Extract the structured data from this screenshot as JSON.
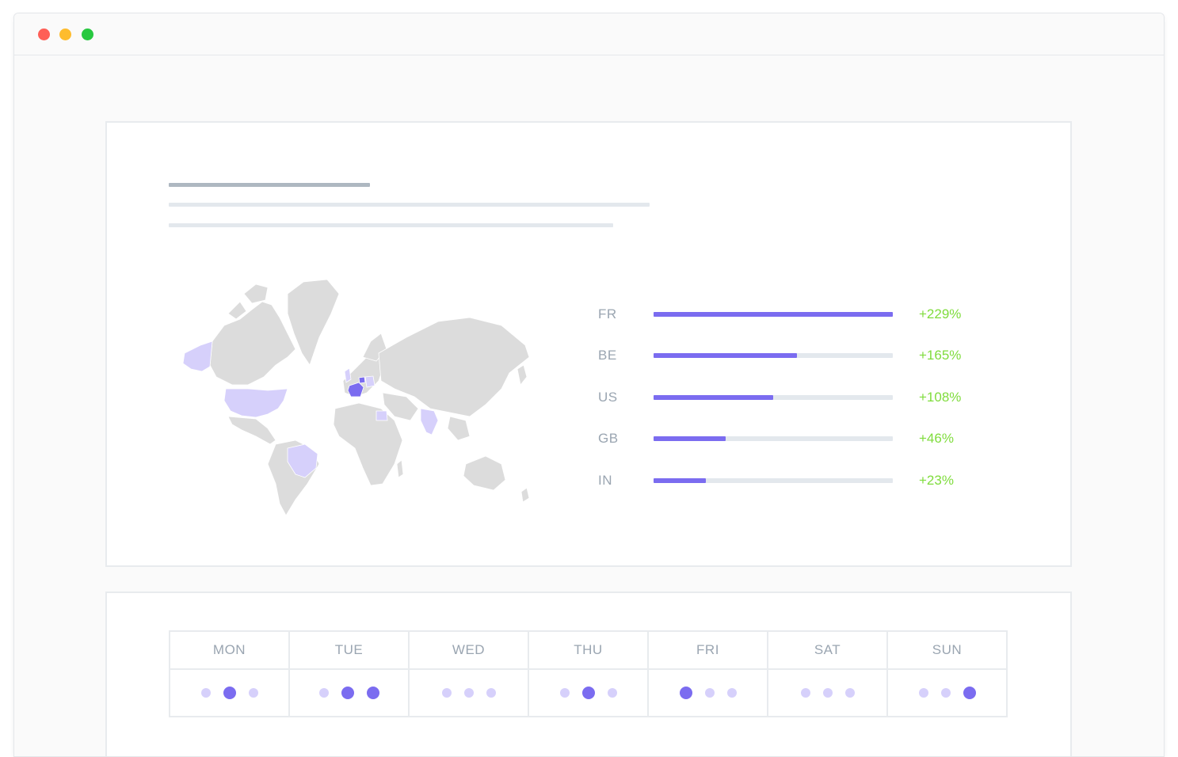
{
  "window": {
    "controls": [
      "close",
      "minimize",
      "maximize"
    ],
    "colors": {
      "close": "#fe5f57",
      "minimize": "#febc2e",
      "maximize": "#28c840"
    }
  },
  "countries": [
    {
      "code": "FR",
      "change": "+229%",
      "fraction": 1.0
    },
    {
      "code": "BE",
      "change": "+165%",
      "fraction": 0.6
    },
    {
      "code": "US",
      "change": "+108%",
      "fraction": 0.5
    },
    {
      "code": "GB",
      "change": "+46%",
      "fraction": 0.3
    },
    {
      "code": "IN",
      "change": "+23%",
      "fraction": 0.22
    }
  ],
  "map_highlights": {
    "strong": [
      "FR",
      "BE"
    ],
    "light": [
      "US",
      "BR",
      "IN",
      "GB",
      "DE",
      "EG"
    ]
  },
  "colors": {
    "accent": "#7b6cf0",
    "accent_light": "#d6d0fb",
    "positive": "#7fdc3c",
    "map_land": "#dcdcdc"
  },
  "weekdays": [
    {
      "label": "MON",
      "dots": [
        "small",
        "big",
        "small"
      ]
    },
    {
      "label": "TUE",
      "dots": [
        "small",
        "big",
        "big"
      ]
    },
    {
      "label": "WED",
      "dots": [
        "small",
        "small",
        "small"
      ]
    },
    {
      "label": "THU",
      "dots": [
        "small",
        "big",
        "small"
      ]
    },
    {
      "label": "FRI",
      "dots": [
        "big",
        "small",
        "small"
      ]
    },
    {
      "label": "SAT",
      "dots": [
        "small",
        "small",
        "small"
      ]
    },
    {
      "label": "SUN",
      "dots": [
        "small",
        "small",
        "big"
      ]
    }
  ]
}
